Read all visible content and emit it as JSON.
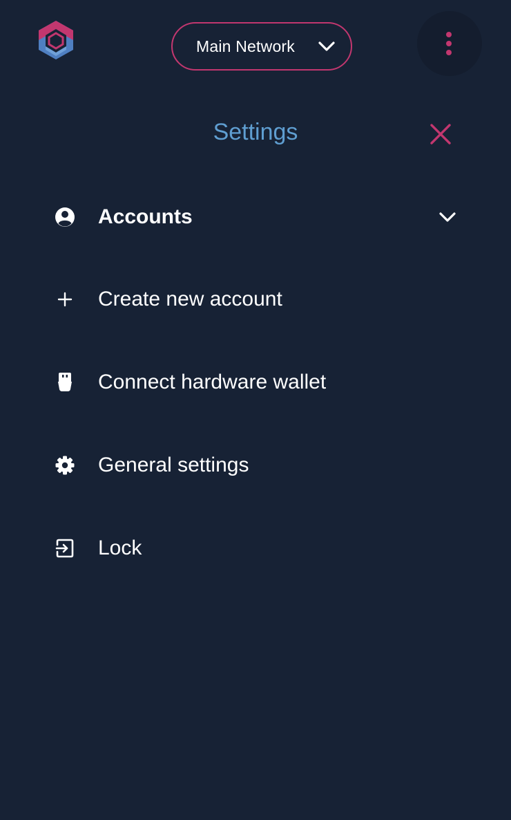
{
  "header": {
    "logo_icon": "hexagon-logo-icon",
    "network": {
      "label": "Main Network",
      "chevron_icon": "chevron-down-icon"
    },
    "menu_icon": "kebab-menu-icon"
  },
  "settings": {
    "title": "Settings",
    "close_icon": "close-icon"
  },
  "menu": {
    "items": [
      {
        "label": "Accounts",
        "icon": "account-circle-icon",
        "expand_icon": "chevron-down-icon"
      },
      {
        "label": "Create new account",
        "icon": "plus-icon"
      },
      {
        "label": "Connect hardware wallet",
        "icon": "usb-plug-icon"
      },
      {
        "label": "General settings",
        "icon": "gear-icon"
      },
      {
        "label": "Lock",
        "icon": "exit-icon"
      }
    ]
  },
  "colors": {
    "background": "#172235",
    "accent": "#c2376f",
    "title_blue": "#5f9ed1",
    "logo_blue": "#4f7fc1"
  }
}
